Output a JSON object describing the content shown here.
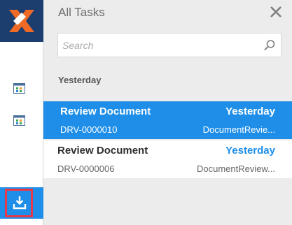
{
  "panel": {
    "title": "All Tasks",
    "search_placeholder": "Search",
    "group_label": "Yesterday"
  },
  "tasks": [
    {
      "title": "Review Document",
      "date": "Yesterday",
      "id": "DRV-0000010",
      "type": "DocumentRevie...",
      "selected": true
    },
    {
      "title": "Review Document",
      "date": "Yesterday",
      "id": "DRV-0000006",
      "type": "DocumentReview...",
      "selected": false
    }
  ],
  "icons": {
    "logo": "x-logo-icon",
    "rail_1": "calendar-app-icon",
    "rail_2": "calendar-app-icon",
    "download": "download-icon",
    "close": "close-icon",
    "search": "search-icon"
  },
  "colors": {
    "logo_bg": "#1b3e6f",
    "logo_orange": "#ee6a25",
    "accent": "#1e8ee8",
    "highlight_frame": "#e8384a"
  }
}
